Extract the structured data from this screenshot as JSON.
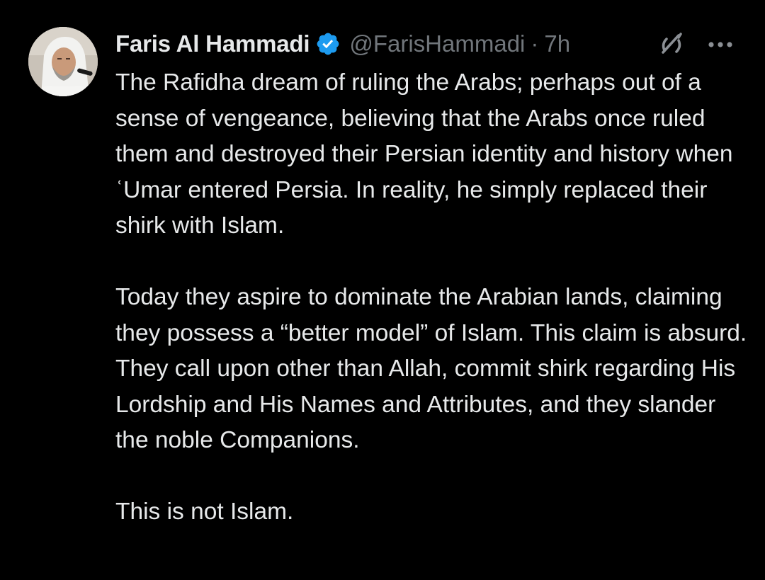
{
  "author": {
    "name": "Faris Al Hammadi",
    "handle": "@FarisHammadi",
    "separator": "·",
    "time": "7h",
    "verified_color": "#1d9bf0"
  },
  "icons": {
    "avatar": "profile-photo",
    "verified": "verified-badge-icon",
    "grok": "grok-icon",
    "more": "more-horizontal-icon"
  },
  "tweet": {
    "paragraphs": [
      "The Rafidha dream of ruling the Arabs; perhaps out of a sense of vengeance, believing that the Arabs once ruled them and destroyed their Persian identity and history when ʿUmar entered Persia. In reality, he simply replaced their shirk with Islam.",
      "Today they aspire to dominate the Arabian lands, claiming they possess a “better model” of Islam. This claim is absurd. They call upon other than Allah, commit shirk regarding His Lordship and His Names and Attributes, and they slander the noble Companions.",
      "This is not Islam."
    ]
  },
  "colors": {
    "background": "#000000",
    "text": "#e7e9ea",
    "secondary": "#71767b"
  }
}
